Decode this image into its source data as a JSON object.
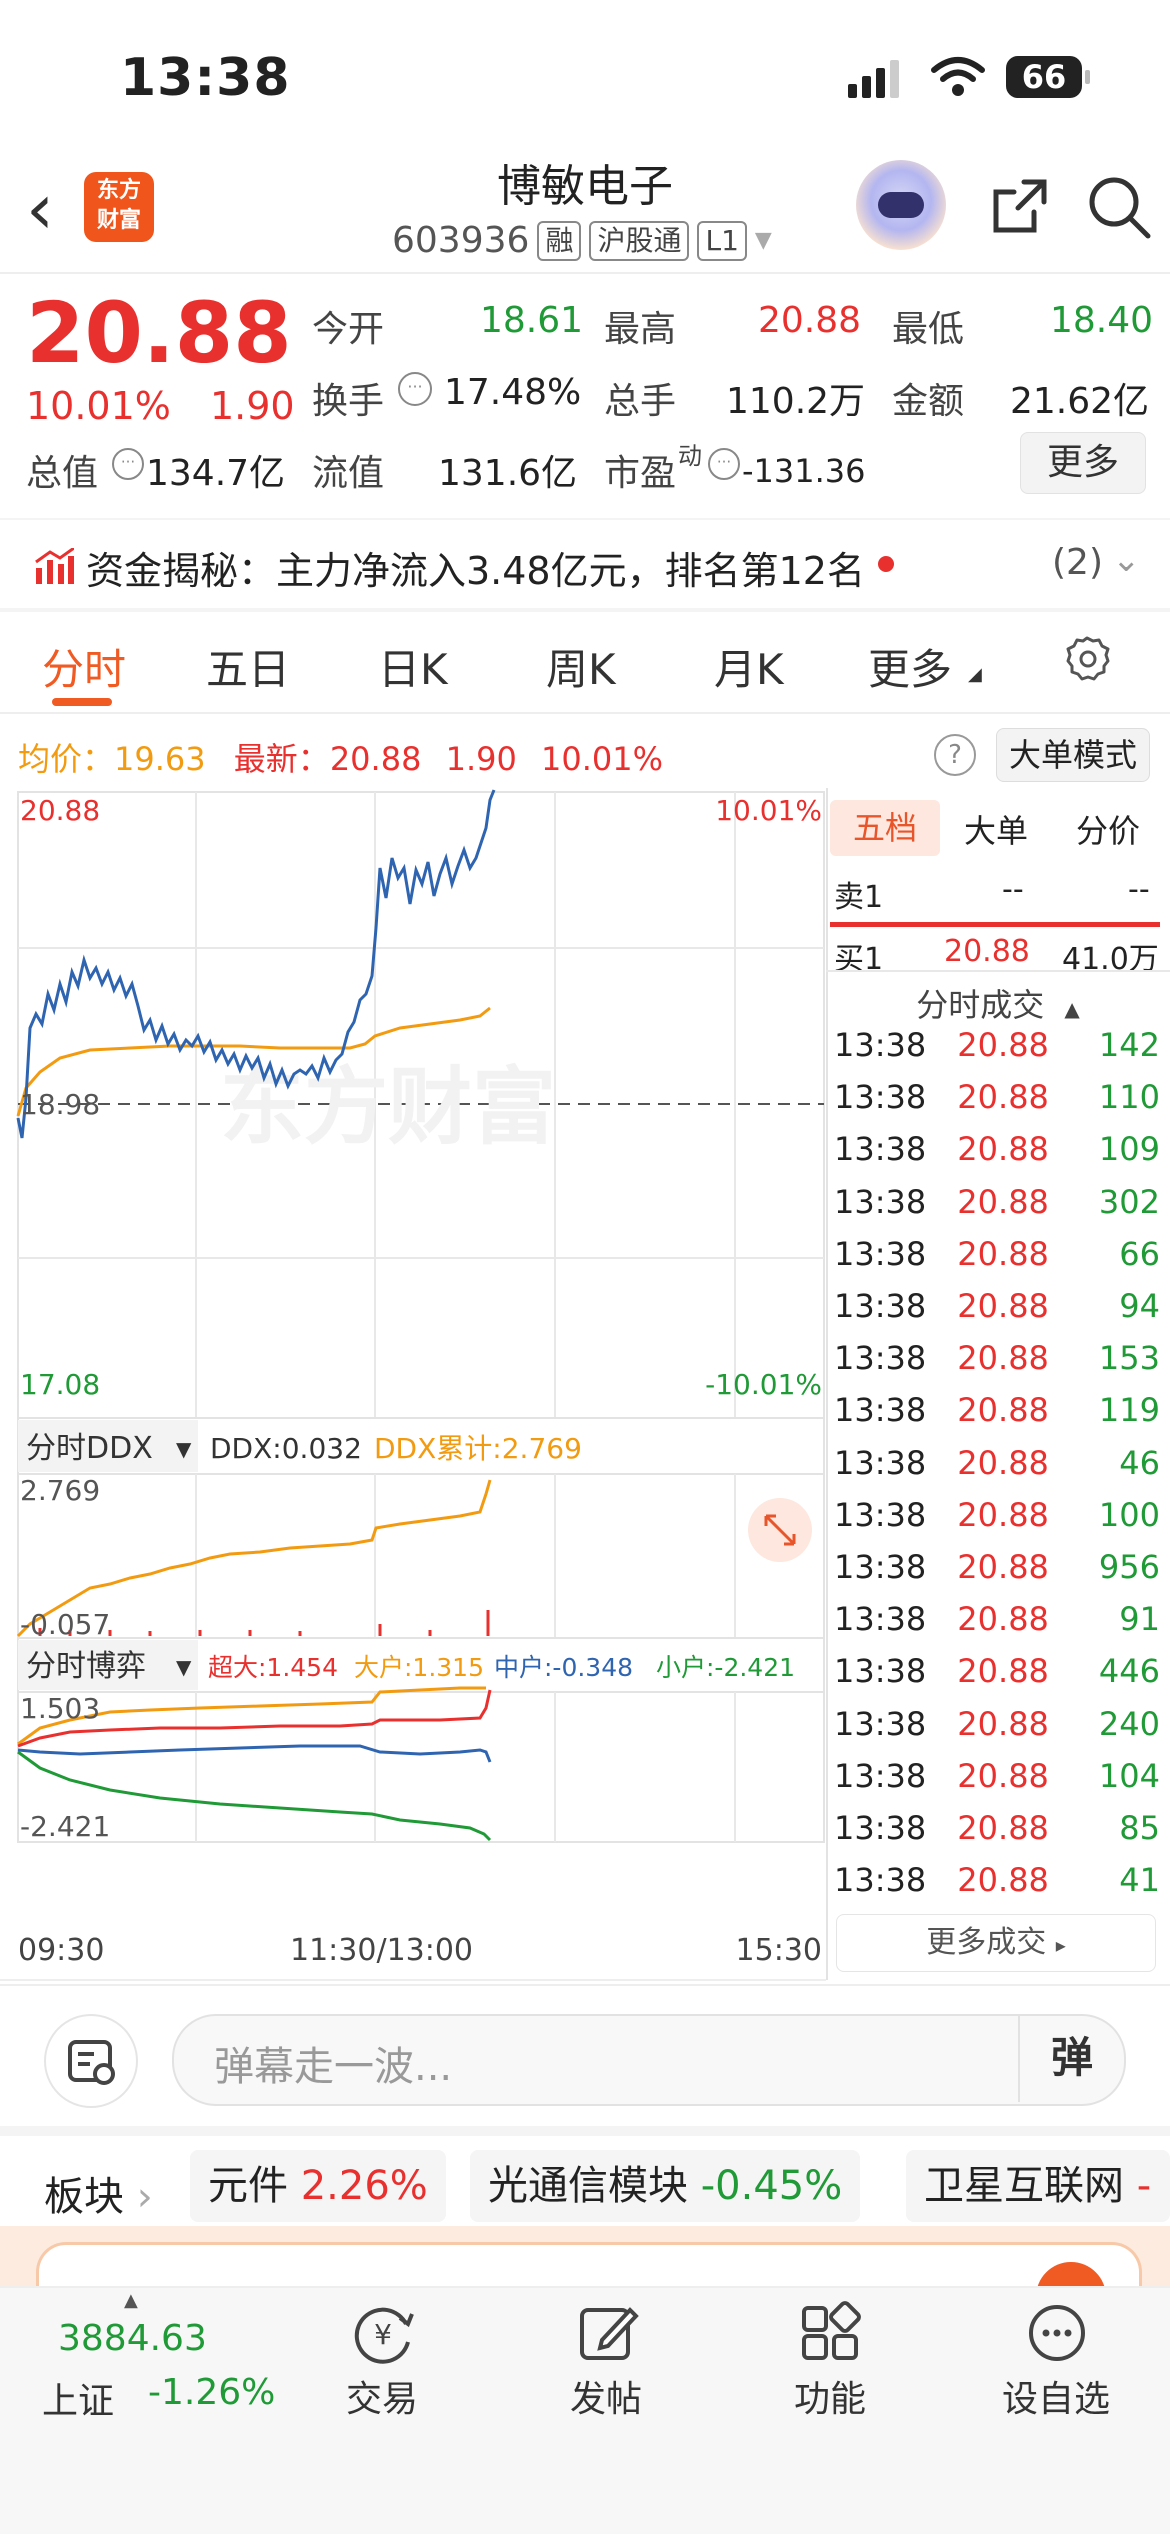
{
  "status_bar": {
    "time": "13:38",
    "battery": "66"
  },
  "header": {
    "logo_line1": "东方",
    "logo_line2": "财富",
    "title": "博敏电子",
    "code": "603936",
    "tags": [
      "融",
      "沪股通",
      "L1"
    ]
  },
  "quote": {
    "price": "20.88",
    "change_pct": "10.01%",
    "change_abs": "1.90",
    "open_label": "今开",
    "open": "18.61",
    "high_label": "最高",
    "high": "20.88",
    "low_label": "最低",
    "low": "18.40",
    "turnover_label": "换手",
    "turnover": "17.48%",
    "volume_label": "总手",
    "volume": "110.2万",
    "amount_label": "金额",
    "amount": "21.62亿",
    "total_mv_label": "总值",
    "total_mv": "134.7亿",
    "float_mv_label": "流值",
    "float_mv": "131.6亿",
    "pe_label": "市盈",
    "pe_sup": "动",
    "pe": "-131.36",
    "more_label": "更多"
  },
  "fund_flow": {
    "text": "资金揭秘：主力净流入3.48亿元，排名第12名",
    "count": "(2)"
  },
  "tabs": [
    "分时",
    "五日",
    "日K",
    "周K",
    "月K",
    "更多"
  ],
  "info_line": {
    "avg_label": "均价：",
    "avg": "19.63",
    "latest_label": "最新：",
    "latest": "20.88",
    "chg": "1.90",
    "pct": "10.01%",
    "big_mode": "大单模式"
  },
  "chart": {
    "price_top": "20.88",
    "price_mid": "18.98",
    "price_bottom": "17.08",
    "pct_top": "10.01%",
    "pct_bottom": "-10.01%",
    "watermark": "东方财富",
    "ddx_title": "分时DDX",
    "ddx_label": "DDX:0.032",
    "ddx_cum": "DDX累计:2.769",
    "ddx_top": "2.769",
    "ddx_bottom": "-0.057",
    "game_title": "分时博弈",
    "game_super": "超大:1.454",
    "game_big": "大户:1.315",
    "game_mid": "中户:-0.348",
    "game_small": "小户:-2.421",
    "game_top": "1.503",
    "game_bottom": "-2.421",
    "x_start": "09:30",
    "x_mid": "11:30/13:00",
    "x_end": "15:30"
  },
  "panel": {
    "tabs": [
      "五档",
      "大单",
      "分价"
    ],
    "sell1": {
      "label": "卖1",
      "price": "--",
      "vol": "--"
    },
    "buy1": {
      "label": "买1",
      "price": "20.88",
      "vol": "41.0万"
    },
    "trades_title": "分时成交",
    "trades": [
      {
        "time": "13:38",
        "price": "20.88",
        "vol": "142"
      },
      {
        "time": "13:38",
        "price": "20.88",
        "vol": "110"
      },
      {
        "time": "13:38",
        "price": "20.88",
        "vol": "109"
      },
      {
        "time": "13:38",
        "price": "20.88",
        "vol": "302"
      },
      {
        "time": "13:38",
        "price": "20.88",
        "vol": "66"
      },
      {
        "time": "13:38",
        "price": "20.88",
        "vol": "94"
      },
      {
        "time": "13:38",
        "price": "20.88",
        "vol": "153"
      },
      {
        "time": "13:38",
        "price": "20.88",
        "vol": "119"
      },
      {
        "time": "13:38",
        "price": "20.88",
        "vol": "46"
      },
      {
        "time": "13:38",
        "price": "20.88",
        "vol": "100"
      },
      {
        "time": "13:38",
        "price": "20.88",
        "vol": "956"
      },
      {
        "time": "13:38",
        "price": "20.88",
        "vol": "91"
      },
      {
        "time": "13:38",
        "price": "20.88",
        "vol": "446"
      },
      {
        "time": "13:38",
        "price": "20.88",
        "vol": "240"
      },
      {
        "time": "13:38",
        "price": "20.88",
        "vol": "104"
      },
      {
        "time": "13:38",
        "price": "20.88",
        "vol": "85"
      },
      {
        "time": "13:38",
        "price": "20.88",
        "vol": "41"
      }
    ],
    "more_trades": "更多成交"
  },
  "danmaku": {
    "placeholder": "弹幕走一波...",
    "send": "弹"
  },
  "sectors": {
    "label": "板块",
    "items": [
      {
        "name": "元件",
        "pct": "2.26%"
      },
      {
        "name": "光通信模块",
        "pct": "-0.45%"
      },
      {
        "name": "卫星互联网",
        "pct": "-"
      }
    ]
  },
  "bottom_nav": {
    "index_value": "3884.63",
    "index_name": "上证",
    "index_change": "-1.26%",
    "items": [
      "交易",
      "发帖",
      "功能",
      "设自选"
    ]
  },
  "colors": {
    "up": "#e8312f",
    "down": "#1f9a36",
    "accent": "#f05a23",
    "avg_line": "#f29b11",
    "price_line": "#2f64b0"
  }
}
